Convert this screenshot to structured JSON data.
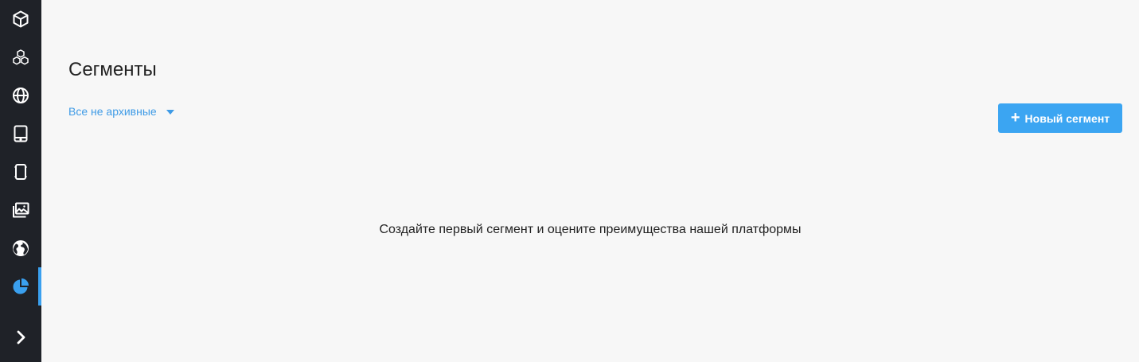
{
  "sidebar": {
    "active_color": "#3aa0ef",
    "items": [
      {
        "icon": "cube-icon",
        "active": false
      },
      {
        "icon": "cubes-icon",
        "active": false
      },
      {
        "icon": "globe-icon",
        "active": false
      },
      {
        "icon": "tablet-icon",
        "active": false
      },
      {
        "icon": "mobile-device-icon",
        "active": false
      },
      {
        "icon": "image-gallery-icon",
        "active": false
      },
      {
        "icon": "earth-icon",
        "active": false
      },
      {
        "icon": "pie-chart-icon",
        "active": true
      },
      {
        "icon": "chevron-right-icon",
        "active": false
      }
    ]
  },
  "main": {
    "title": "Сегменты",
    "filter": {
      "label": "Все не архивные",
      "icon": "caret-down-icon"
    },
    "new_button": {
      "label": "Новый сегмент",
      "icon": "plus-icon",
      "color": "#3ba5f2"
    },
    "empty_message": "Создайте первый сегмент и оцените преимущества нашей платформы"
  }
}
